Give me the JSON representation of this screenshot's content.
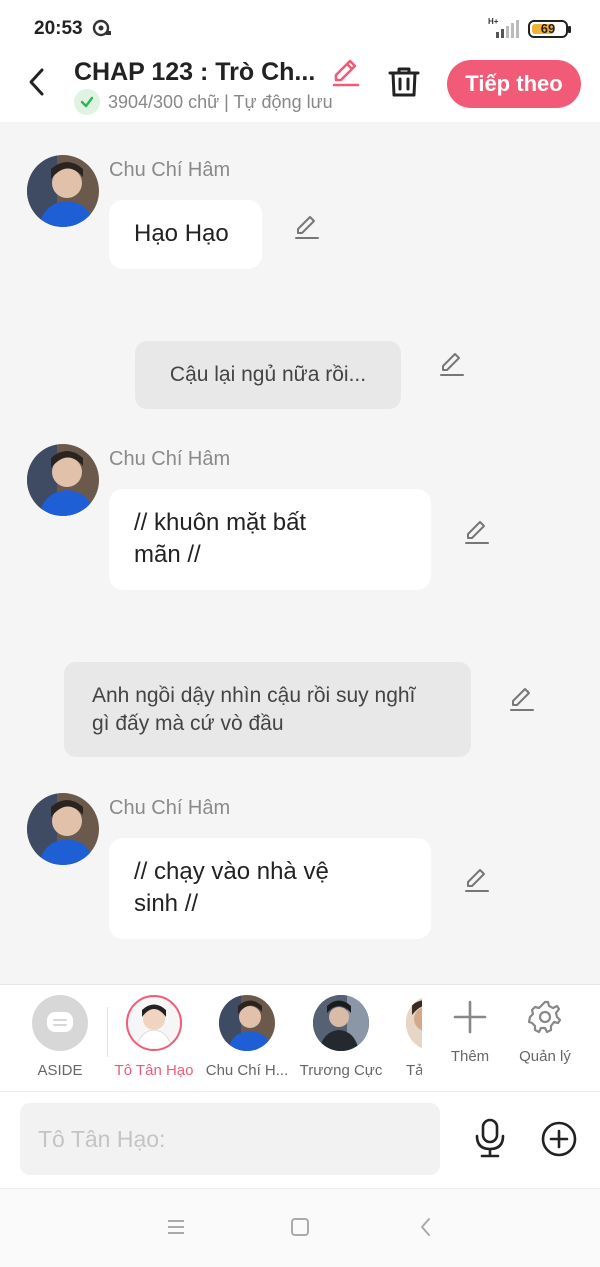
{
  "status_bar": {
    "time": "20:53",
    "network": "H+",
    "battery": "69",
    "battery_level": 0.69
  },
  "header": {
    "title": "CHAP 123 : Trò Ch...",
    "subtitle": "3904/300 chữ | Tự động lưu",
    "next_label": "Tiếp theo"
  },
  "messages": [
    {
      "type": "dialogue",
      "speaker": "Chu Chí Hâm",
      "lines": [
        "Hạo Hạo"
      ]
    },
    {
      "type": "narration",
      "lines": [
        "Cậu lại ngủ nữa rồi..."
      ]
    },
    {
      "type": "dialogue",
      "speaker": "Chu Chí Hâm",
      "lines": [
        "// khuôn mặt bất",
        "mãn //"
      ]
    },
    {
      "type": "narration",
      "lines": [
        "Anh ngồi dậy nhìn cậu rồi suy nghĩ",
        "gì đấy mà cứ vò đầu"
      ]
    },
    {
      "type": "dialogue",
      "speaker": "Chu Chí Hâm",
      "lines": [
        "// chạy vào nhà vệ",
        "sinh //"
      ]
    }
  ],
  "characters": [
    {
      "label": "ASIDE",
      "icon": "aside-icon"
    },
    {
      "label": "Tô Tân Hạo",
      "active": true
    },
    {
      "label": "Chu Chí H..."
    },
    {
      "label": "Trương Cực"
    },
    {
      "label": "Tả"
    }
  ],
  "tools": {
    "more_label": "Thêm",
    "manage_label": "Quản lý"
  },
  "input": {
    "placeholder": "Tô Tân Hạo:"
  },
  "colors": {
    "accent": "#f25b78",
    "chat_bg": "#f5f5f5",
    "narration_bg": "#e8e8e8",
    "avatar_jacket": "#1f5fd6"
  }
}
